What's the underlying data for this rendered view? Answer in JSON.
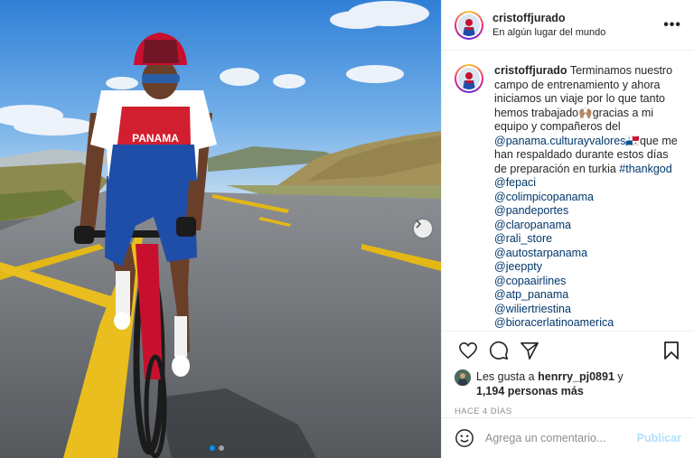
{
  "post": {
    "username": "cristoffjurado",
    "location": "En algún lugar del mundo",
    "more_icon": "more-horizontal-icon"
  },
  "caption": {
    "username": "cristoffjurado",
    "text_1": "Terminamos nuestro campo de entrenamiento y ahora iniciamos un viaje por lo que tanto hemos trabajado",
    "emoji_1": "🙌🏽",
    "text_2": "gracias a mi equipo y compañeros del",
    "mention_1": "@panama.culturayvalores",
    "emoji_2": "🇵🇦",
    "text_3": "que me han respaldado durante estos días de preparación en turkia",
    "hashtag": "#thankgod",
    "mentions": [
      "@fepaci",
      "@colimpicopanama",
      "@pandeportes",
      "@claropanama",
      "@rali_store",
      "@autostarpanama",
      "@jeeppty",
      "@copaairlines",
      "@atp_panama",
      "@wiliertriestina",
      "@bioracerlatinoamerica"
    ]
  },
  "photo": {
    "jersey_text": "PANAMA",
    "carousel_dots": 2,
    "active_dot": 0
  },
  "actions": {
    "icons": [
      "heart-icon",
      "comment-icon",
      "share-icon",
      "bookmark-icon"
    ]
  },
  "likes": {
    "prefix": "Les gusta a",
    "user": "henrry_pj0891",
    "connector": "y",
    "count": "1,194 personas más"
  },
  "timestamp": "HACE 4 DÍAS",
  "comment": {
    "placeholder": "Agrega un comentario...",
    "publish_label": "Publicar"
  },
  "colors": {
    "link": "#00376b",
    "publish_disabled": "#b2dffc",
    "carousel_active": "#0095f6"
  }
}
